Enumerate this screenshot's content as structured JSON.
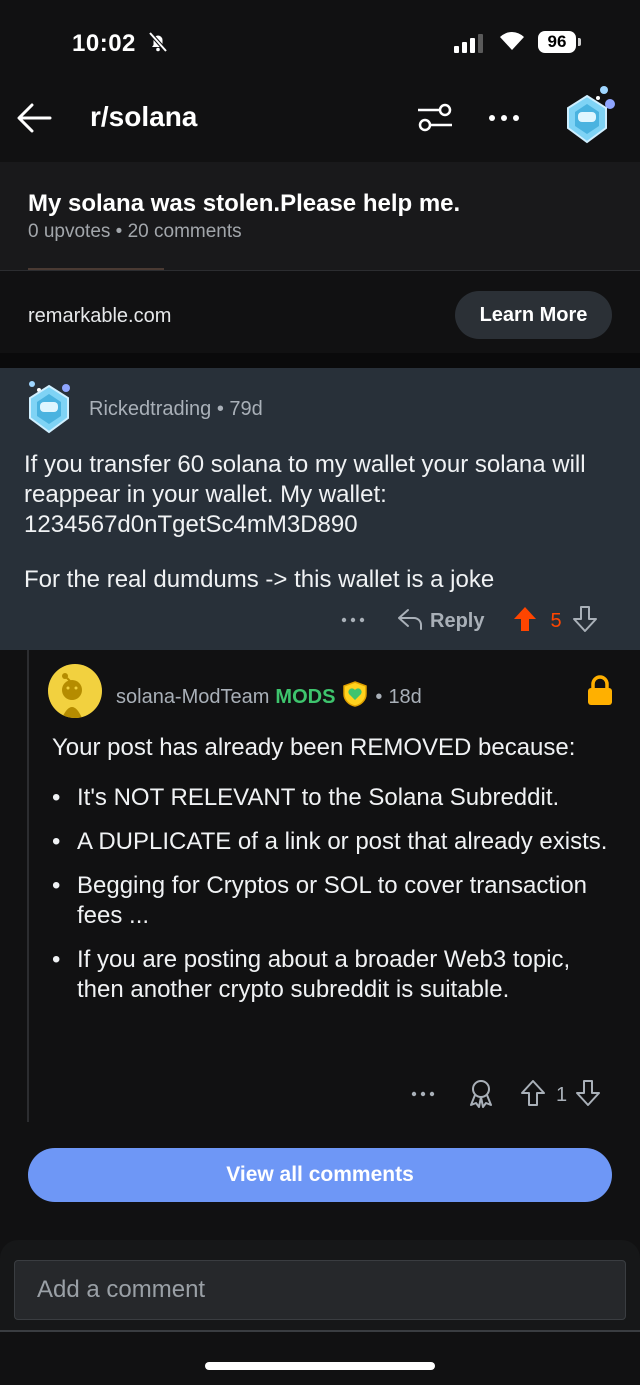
{
  "status_bar": {
    "time": "10:02",
    "battery": "96"
  },
  "nav": {
    "title": "r/solana"
  },
  "post": {
    "title": "My solana was stolen.Please help me.",
    "meta": "0 upvotes • 20 comments"
  },
  "ad": {
    "domain": "remarkable.com",
    "cta": "Learn More"
  },
  "comment1": {
    "user": "Rickedtrading",
    "age": "79d",
    "paragraph1": "If you transfer 60 solana to my wallet your solana will reappear in your wallet. My wallet: 1234567d0nTgetSc4mM3D890",
    "paragraph2": "For the real dumdums -> this wallet is a joke",
    "reply_label": "Reply",
    "votes": "5",
    "upvote_color": "#ff4500"
  },
  "comment2": {
    "user": "solana-ModTeam",
    "badge": "MODS",
    "age": "18d",
    "intro": "Your post has already been REMOVED because:",
    "reasons": [
      "It's NOT RELEVANT to the Solana Subreddit.",
      "A DUPLICATE of a link or post that already exists.",
      "Begging for Cryptos or SOL to cover transaction fees ...",
      "If you are posting about a broader Web3 topic, then another crypto subreddit is suitable."
    ],
    "votes": "1",
    "badge_color": "#3ec46d",
    "lock_color": "#ffb000"
  },
  "view_all": {
    "label": "View all comments"
  },
  "composer": {
    "placeholder": "Add a comment"
  },
  "colors": {
    "accent": "#6e97f6",
    "highlight_bg": "#283039"
  }
}
